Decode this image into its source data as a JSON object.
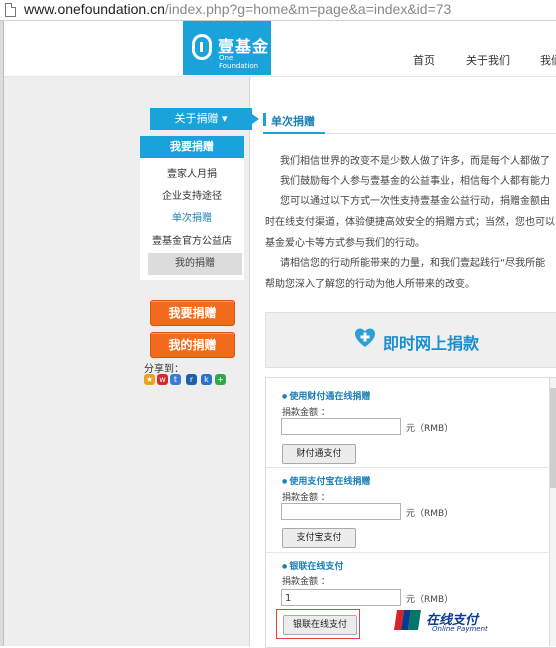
{
  "browser": {
    "url_host": "www.onefoundation.cn",
    "url_path": "/index.php?g=home&m=page&a=index&id=73"
  },
  "header": {
    "logo_cn": "壹基金",
    "logo_en": "One Foundation",
    "nav": [
      "首页",
      "关于我们",
      "我们"
    ]
  },
  "sidebar": {
    "about_label": "关于捐赠",
    "donate_head": "我要捐赠",
    "items": [
      "壹家人月捐",
      "企业支持途径",
      "单次捐赠",
      "壹基金官方公益店"
    ],
    "my_donation": "我的捐赠",
    "btn_donate": "我要捐赠",
    "btn_mine": "我的捐赠",
    "share_label": "分享到："
  },
  "main": {
    "tab": "单次捐赠",
    "paragraphs": [
      "我们相信世界的改变不是少数人做了许多，而是每个人都做了",
      "我们鼓励每个人参与壹基金的公益事业，相信每个人都有能力",
      "您可以通过以下方式一次性支持壹基金公益行动，捐赠金额由",
      "时在线支付渠道，体验便捷高效安全的捐赠方式；当然，您也可以",
      "基金爱心卡等方式参与我们的行动。",
      "请相信您的行动所能带来的力量，和我们壹起践行“尽我所能",
      "帮助您深入了解您的行动为他人所带来的改变。"
    ],
    "online_title": "即时网上捐款",
    "methods": [
      {
        "title": "使用财付通在线捐赠",
        "amount_label": "捐款金额 ：",
        "value": "",
        "unit": "元（RMB）",
        "button": "财付通支付"
      },
      {
        "title": "使用支付宝在线捐赠",
        "amount_label": "捐款金额 ：",
        "value": "",
        "unit": "元（RMB）",
        "button": "支付宝支付"
      },
      {
        "title": "银联在线支付",
        "amount_label": "捐款金额 ：",
        "value": "1",
        "unit": "元（RMB）",
        "button": "银联在线支付"
      }
    ],
    "unionpay_cn": "在线支付",
    "unionpay_en": "Online Payment"
  },
  "colors": {
    "accent": "#1aa3db",
    "orange": "#f26b1d"
  }
}
